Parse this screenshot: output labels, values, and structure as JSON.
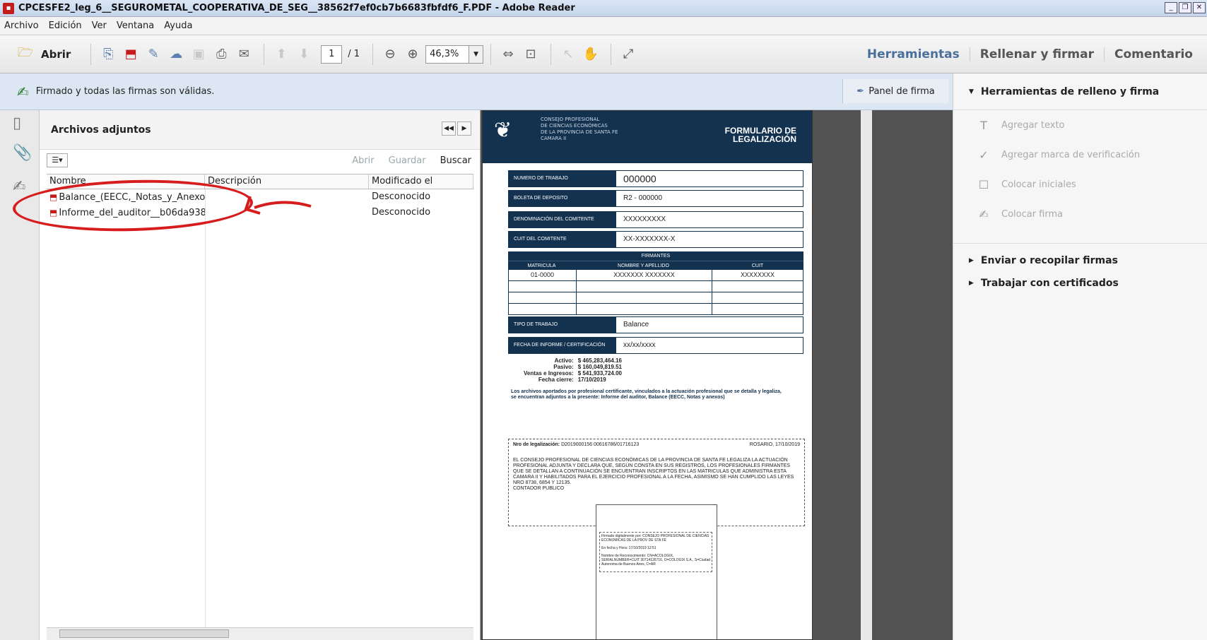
{
  "window": {
    "title": "CPCESFE2_leg_6__SEGUROMETAL_COOPERATIVA_DE_SEG__38562f7ef0cb7b6683fbfdf6_F.PDF - Adobe Reader"
  },
  "menu": [
    "Archivo",
    "Edición",
    "Ver",
    "Ventana",
    "Ayuda"
  ],
  "toolbar": {
    "open_label": "Abrir",
    "page_current": "1",
    "page_total": "/ 1",
    "zoom": "46,3%",
    "right_links": [
      "Herramientas",
      "Rellenar y firmar",
      "Comentario"
    ]
  },
  "signature_bar": {
    "message": "Firmado y todas las firmas son válidas.",
    "panel_button": "Panel de firma"
  },
  "attachments": {
    "header": "Archivos adjuntos",
    "actions": [
      "Abrir",
      "Guardar",
      "Buscar"
    ],
    "columns": [
      "Nombre",
      "Descripción",
      "Modificado el"
    ],
    "rows": [
      {
        "name": "Balance_(EECC,_Notas_y_Anexo...",
        "description": "",
        "modified": "Desconocido"
      },
      {
        "name": "Informe_del_auditor__b06da938...",
        "description": "",
        "modified": "Desconocido"
      }
    ]
  },
  "document": {
    "org_lines": [
      "CONSEJO PROFESIONAL",
      "DE CIENCIAS ECONÓMICAS",
      "DE LA PROVINCIA DE SANTA FE",
      "CAMARA II"
    ],
    "logo_text": "CPCE",
    "form_title": [
      "FORMULARIO DE",
      "LEGALIZACIÓN"
    ],
    "fields": [
      {
        "label": "NUMERO DE TRABAJO",
        "value": "000000"
      },
      {
        "label": "BOLETA DE DEPOSITO",
        "value": "R2 - 000000"
      },
      {
        "label": "DENOMINACIÓN DEL COMITENTE",
        "value": "XXXXXXXXX"
      },
      {
        "label": "CUIT DEL COMITENTE",
        "value": "XX-XXXXXXX-X"
      }
    ],
    "firmantes": {
      "title": "FIRMANTES",
      "headers": [
        "MATRICULA",
        "NOMBRE Y APELLIDO",
        "CUIT"
      ],
      "row": [
        "01-0000",
        "XXXXXXX XXXXXXX",
        "XXXXXXXX"
      ]
    },
    "tipo": {
      "label": "TIPO DE TRABAJO",
      "value": "Balance"
    },
    "fecha": {
      "label": "FECHA DE INFORME / CERTIFICACIÓN",
      "value": "xx/xx/xxxx"
    },
    "totals": {
      "labels": [
        "Activo:",
        "Pasivo:",
        "Ventas e Ingresos:",
        "Fecha cierre:"
      ],
      "values": [
        "$ 465,283,464.16",
        "$ 160,049,819.51",
        "$ 541,933,724.00",
        "17/10/2019"
      ]
    },
    "note": "Los archivos aportados por profesional certificante, vinculados a la actuación profesional que se detalla y legaliza, se encuentran adjuntos a la presente: Informe del auditor, Balance (EECC, Notas y anexos)",
    "legal": {
      "nro_label": "Nro de legalización:",
      "nro_value": "D2019000156 00616786/01716123",
      "place_date": "ROSARIO, 17/10/2019",
      "body": "EL CONSEJO PROFESIONAL DE CIENCIAS ECONÓMICAS DE LA PROVINCIA DE SANTA FE LEGALIZA LA ACTUACIÓN PROFESIONAL ADJUNTA Y DECLARA QUE, SEGÚN CONSTA EN SUS REGISTROS, LOS PROFESIONALES FIRMANTES QUE SE DETALLAN A CONTINUACIÓN SE ENCUENTRAN INSCRIPTOS EN LAS MATRICULAS QUE ADMINISTRA ESTA CAMARA II Y HABILITADOS PARA EL EJERCICIO PROFESIONAL A LA FECHA, ASIMISMO SE HAN CUMPLIDO LAS LEYES NRO 8738, 6854 Y 12135.",
      "role": "CONTADOR PUBLICO"
    },
    "stamp": [
      "Firmado digitalmente por: CONSEJO PROFESIONAL DE CIENCIAS ECONOMICAS DE LA PROV DE STA FE",
      "En fecha y Hora: 17/10/2019 12:51",
      "Nombre de Reconocimiento: CN=ACOLOGIX, SERIALNUMBER=CUIT 30714126716, O=COLOGIX S.A., S=Ciudad Autonoma de Buenos Aires, C=AR"
    ]
  },
  "right_panel": {
    "header": "Herramientas de relleno y firma",
    "items": [
      "Agregar texto",
      "Agregar marca de verificación",
      "Colocar iniciales",
      "Colocar firma"
    ],
    "sections": [
      "Enviar o recopilar firmas",
      "Trabajar con certificados"
    ]
  }
}
